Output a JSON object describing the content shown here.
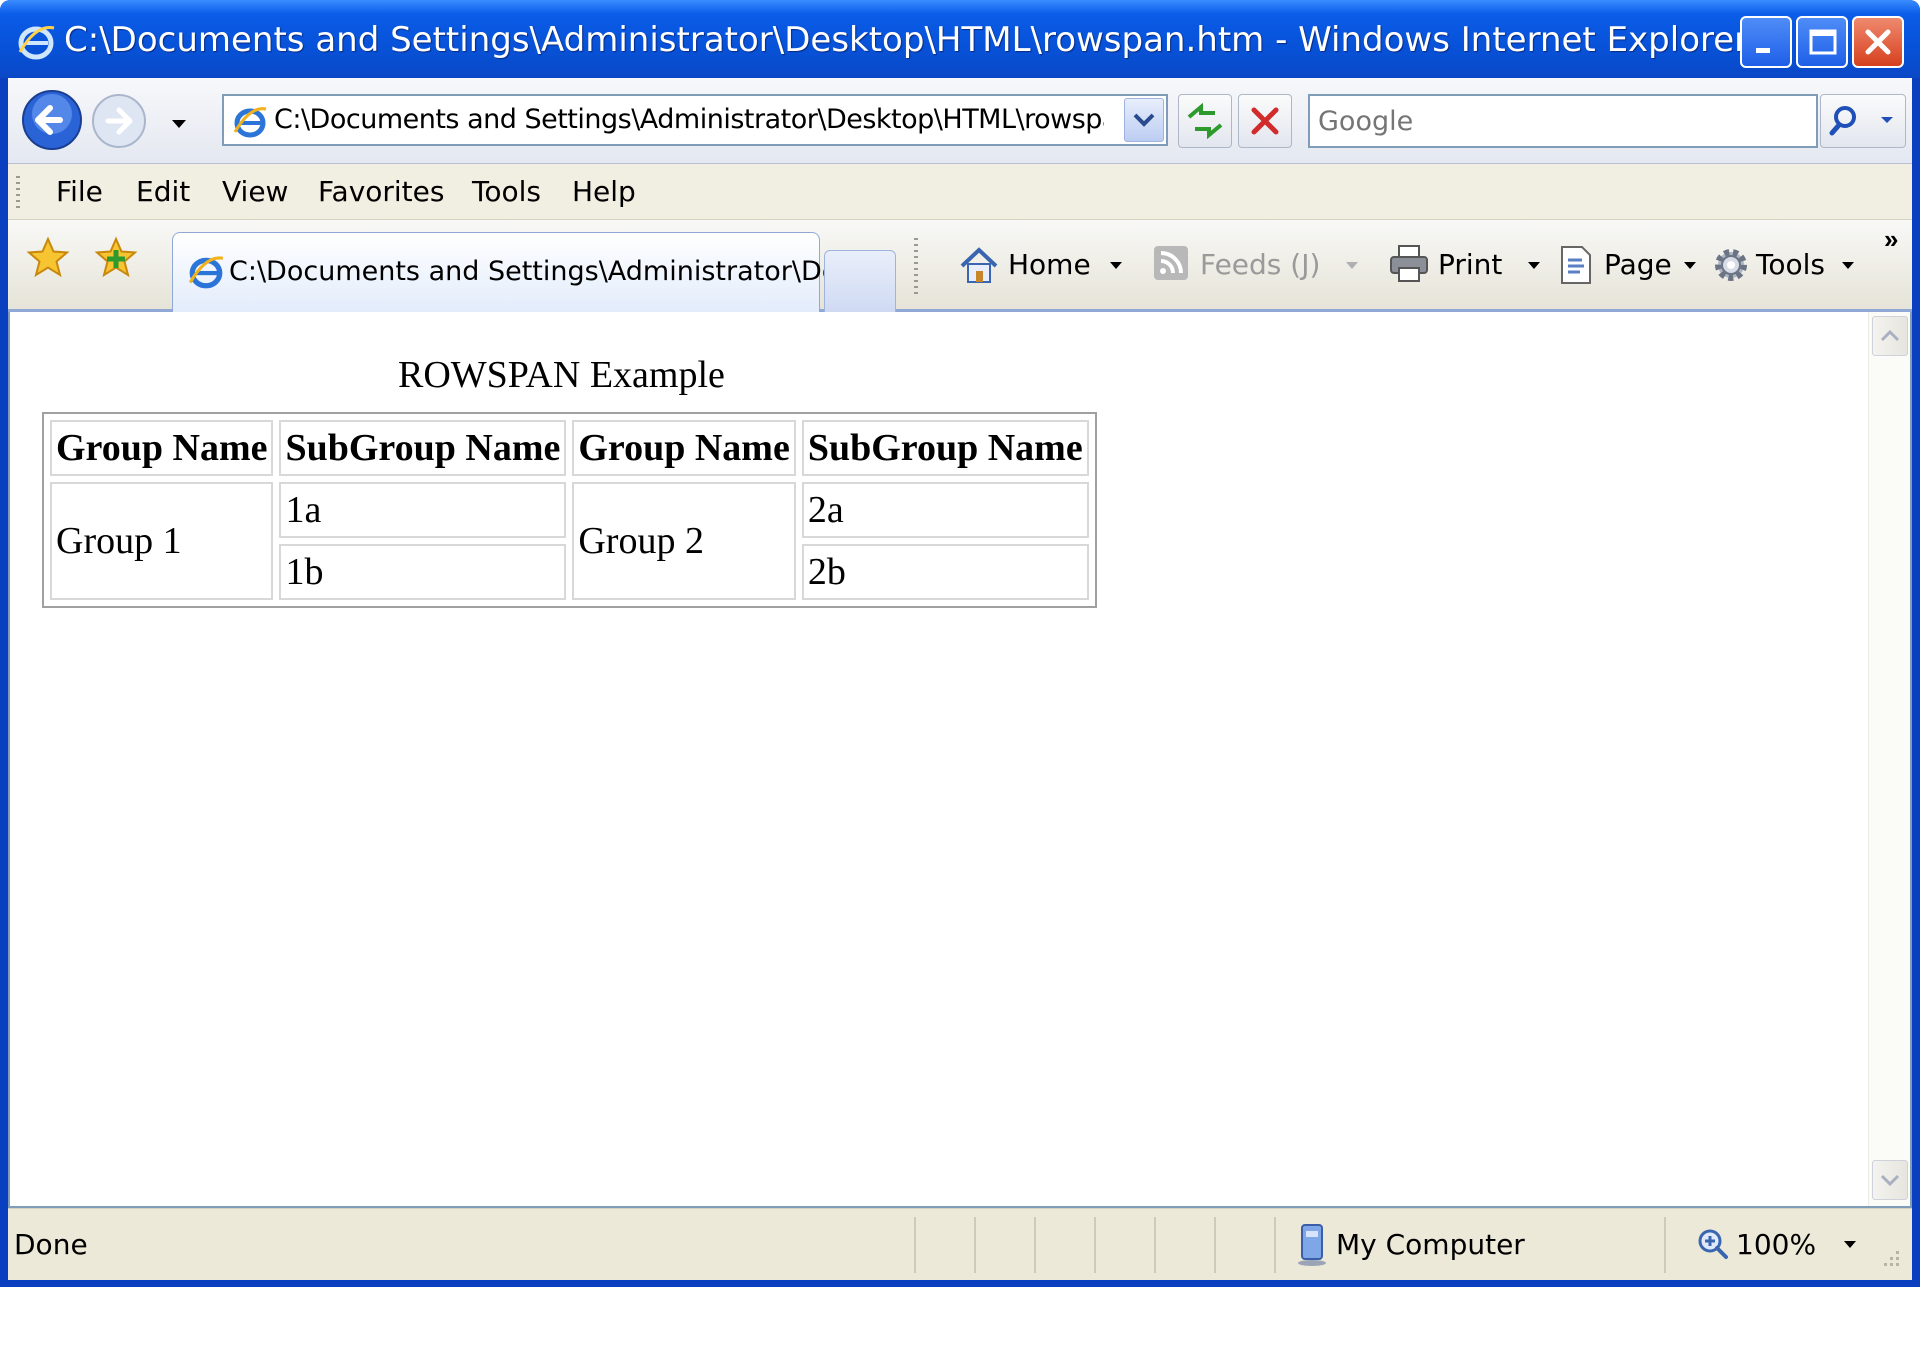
{
  "window": {
    "title": "C:\\Documents and Settings\\Administrator\\Desktop\\HTML\\rowspan.htm - Windows Internet Explorer"
  },
  "address_bar": {
    "value": "C:\\Documents and Settings\\Administrator\\Desktop\\HTML\\rowspan.htm"
  },
  "search": {
    "placeholder": "Google"
  },
  "menu": {
    "items": [
      "File",
      "Edit",
      "View",
      "Favorites",
      "Tools",
      "Help"
    ]
  },
  "tabs": {
    "active_label": "C:\\Documents and Settings\\Administrator\\De..."
  },
  "command_bar": {
    "home": "Home",
    "feeds": "Feeds (J)",
    "print": "Print",
    "page": "Page",
    "tools": "Tools"
  },
  "page": {
    "title": "ROWSPAN Example",
    "headers": [
      "Group Name",
      "SubGroup Name",
      "Group Name",
      "SubGroup Name"
    ],
    "groups": [
      {
        "name": "Group 1",
        "subgroups": [
          "1a",
          "1b"
        ]
      },
      {
        "name": "Group 2",
        "subgroups": [
          "2a",
          "2b"
        ]
      }
    ]
  },
  "status_bar": {
    "text": "Done",
    "zone": "My Computer",
    "zoom": "100%"
  },
  "colors": {
    "titlebar": "#0752d8",
    "frame": "#ece9d8",
    "close_button": "#d6401e"
  },
  "icons": [
    "ie-logo-icon",
    "back-arrow-icon",
    "forward-arrow-icon",
    "refresh-icon",
    "stop-icon",
    "search-icon",
    "favorites-star-icon",
    "add-favorites-icon",
    "home-icon",
    "feeds-icon",
    "print-icon",
    "page-icon",
    "tools-gear-icon",
    "computer-icon",
    "zoom-icon"
  ]
}
